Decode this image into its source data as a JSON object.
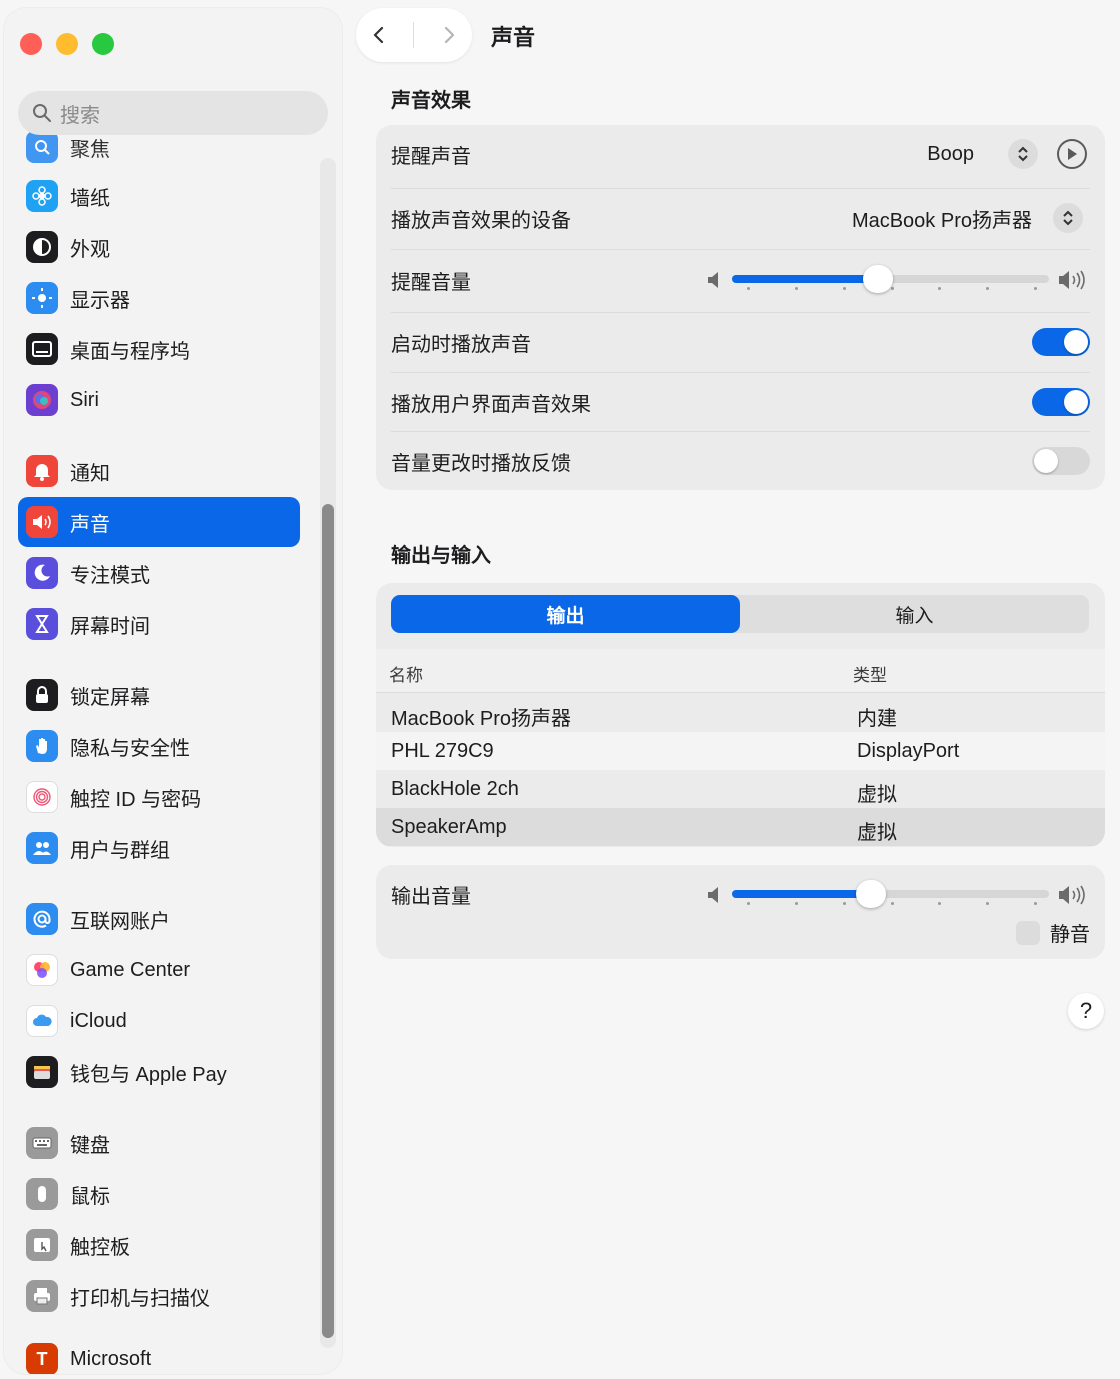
{
  "window": {
    "title": "声音"
  },
  "search": {
    "placeholder": "搜索"
  },
  "sidebar": {
    "partial_top_label": "聚焦",
    "items": [
      {
        "label": "墙纸",
        "icon": "wallpaper-icon",
        "color": "#1fa2f3"
      },
      {
        "label": "外观",
        "icon": "appearance-icon",
        "color": "#1d1d1f"
      },
      {
        "label": "显示器",
        "icon": "display-icon",
        "color": "#2d8cf0"
      },
      {
        "label": "桌面与程序坞",
        "icon": "dock-icon",
        "color": "#1d1d1f"
      },
      {
        "label": "Siri",
        "icon": "siri-icon",
        "color": "#6c3fd1"
      },
      {
        "label": "通知",
        "icon": "bell-icon",
        "color": "#f0453a"
      },
      {
        "label": "声音",
        "icon": "speaker-icon",
        "color": "#f0453a"
      },
      {
        "label": "专注模式",
        "icon": "moon-icon",
        "color": "#5a4fdc"
      },
      {
        "label": "屏幕时间",
        "icon": "hourglass-icon",
        "color": "#5a4fdc"
      },
      {
        "label": "锁定屏幕",
        "icon": "lock-icon",
        "color": "#1d1d1f"
      },
      {
        "label": "隐私与安全性",
        "icon": "hand-icon",
        "color": "#2d8cf0"
      },
      {
        "label": "触控 ID 与密码",
        "icon": "fingerprint-icon",
        "color": "#ffffff"
      },
      {
        "label": "用户与群组",
        "icon": "users-icon",
        "color": "#2d8cf0"
      },
      {
        "label": "互联网账户",
        "icon": "at-icon",
        "color": "#2d8cf0"
      },
      {
        "label": "Game Center",
        "icon": "game-center-icon",
        "color": "#ffffff"
      },
      {
        "label": "iCloud",
        "icon": "cloud-icon",
        "color": "#ffffff"
      },
      {
        "label": "钱包与 Apple Pay",
        "icon": "wallet-icon",
        "color": "#1d1d1f"
      },
      {
        "label": "键盘",
        "icon": "keyboard-icon",
        "color": "#9a9a9a"
      },
      {
        "label": "鼠标",
        "icon": "mouse-icon",
        "color": "#9a9a9a"
      },
      {
        "label": "触控板",
        "icon": "trackpad-icon",
        "color": "#9a9a9a"
      },
      {
        "label": "打印机与扫描仪",
        "icon": "printer-icon",
        "color": "#9a9a9a"
      }
    ],
    "partial_bottom_label": "Microsoft",
    "active_index": 6
  },
  "sound_effects": {
    "section_title": "声音效果",
    "alert_sound_label": "提醒声音",
    "alert_sound_value": "Boop",
    "output_device_label": "播放声音效果的设备",
    "output_device_value": "MacBook Pro扬声器",
    "alert_volume_label": "提醒音量",
    "alert_volume_level": 0.46,
    "startup_sound_label": "启动时播放声音",
    "startup_sound_on": true,
    "ui_sounds_label": "播放用户界面声音效果",
    "ui_sounds_on": true,
    "volume_feedback_label": "音量更改时播放反馈",
    "volume_feedback_on": false
  },
  "output_input": {
    "section_title": "输出与输入",
    "tabs": [
      "输出",
      "输入"
    ],
    "active_tab": 0,
    "columns": [
      "名称",
      "类型"
    ],
    "devices": [
      {
        "name": "MacBook Pro扬声器",
        "type": "内建"
      },
      {
        "name": "PHL 279C9",
        "type": "DisplayPort"
      },
      {
        "name": "BlackHole 2ch",
        "type": "虚拟"
      },
      {
        "name": "SpeakerAmp",
        "type": "虚拟"
      }
    ],
    "selected_index": 3
  },
  "output_volume": {
    "label": "输出音量",
    "level": 0.44,
    "mute_label": "静音",
    "muted": false
  },
  "help": {
    "label": "?"
  },
  "colors": {
    "accent": "#0a68e8"
  }
}
